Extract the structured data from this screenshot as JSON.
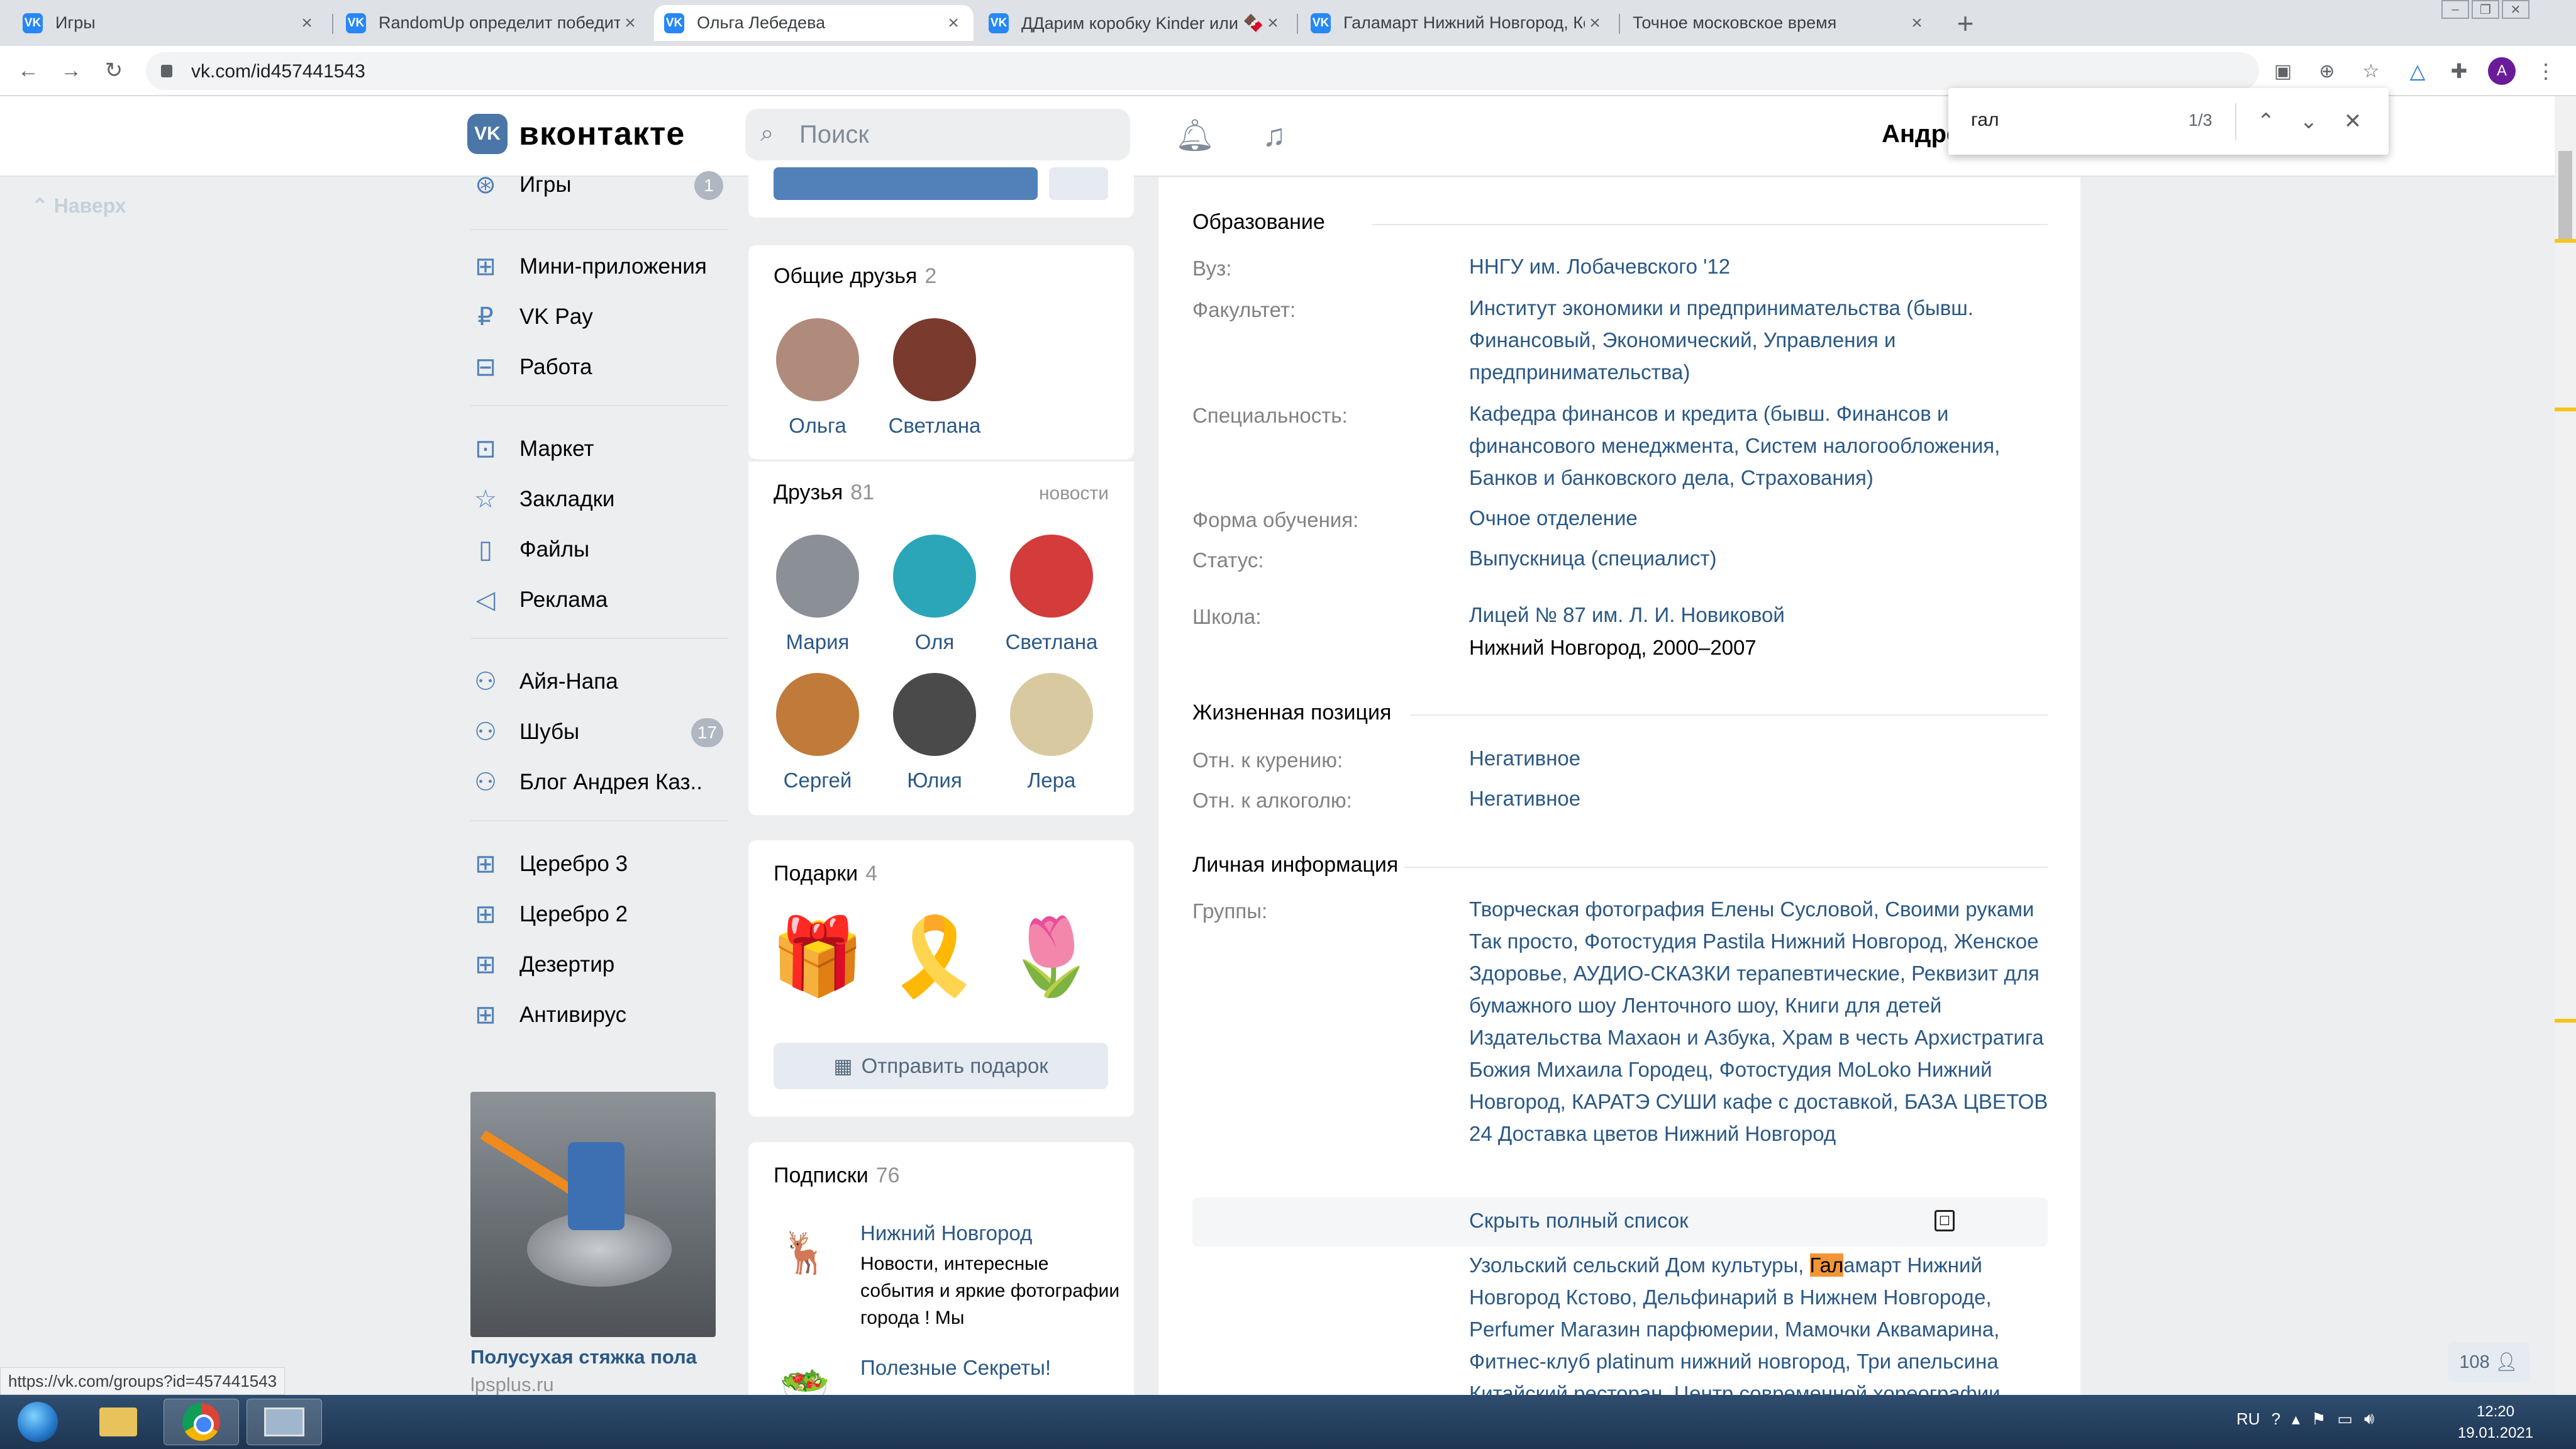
{
  "browser": {
    "tabs": [
      {
        "title": "Игры",
        "favicon": "vk-icon"
      },
      {
        "title": "RandomUp определит победите",
        "favicon": "vk-icon"
      },
      {
        "title": "Ольга Лебедева",
        "favicon": "vk-icon",
        "active": true
      },
      {
        "title": "ДДарим коробку Kinder или 🍫",
        "favicon": "vk-icon"
      },
      {
        "title": "Галамарт Нижний Новгород, Кс",
        "favicon": "vk-icon"
      },
      {
        "title": "Точное московское время",
        "favicon": "clock-icon"
      }
    ],
    "url": "vk.com/id457441543",
    "profile_initial": "A",
    "status_url": "https://vk.com/groups?id=457441543"
  },
  "find": {
    "query": "гал",
    "count": "1/3"
  },
  "vk": {
    "logo_text": "вконтакте",
    "search_placeholder": "Поиск",
    "user_name": "Андре"
  },
  "left_nav": {
    "back_to_top": "Наверх",
    "items": [
      {
        "label": "Игры",
        "icon": "gamepad-icon",
        "badge": "1"
      },
      {
        "label": "Мини-приложения",
        "icon": "apps-icon"
      },
      {
        "label": "VK Pay",
        "icon": "ruble-icon"
      },
      {
        "label": "Работа",
        "icon": "briefcase-icon"
      },
      {
        "label": "Маркет",
        "icon": "bag-icon"
      },
      {
        "label": "Закладки",
        "icon": "star-icon"
      },
      {
        "label": "Файлы",
        "icon": "file-icon"
      },
      {
        "label": "Реклама",
        "icon": "megaphone-icon"
      },
      {
        "label": "Айя-Напа",
        "icon": "group-icon"
      },
      {
        "label": "Шубы",
        "icon": "group-icon",
        "badge": "17"
      },
      {
        "label": "Блог Андрея Каз..",
        "icon": "group-icon"
      },
      {
        "label": "Церебро 3",
        "icon": "apps-icon"
      },
      {
        "label": "Церебро 2",
        "icon": "apps-icon"
      },
      {
        "label": "Дезертир",
        "icon": "apps-icon"
      },
      {
        "label": "Антивирус",
        "icon": "apps-icon"
      }
    ],
    "ad": {
      "title": "Полусухая стяжка пола",
      "domain": "lpsplus.ru"
    }
  },
  "mutual_friends": {
    "title": "Общие друзья",
    "count": "2",
    "people": [
      {
        "name": "Ольга",
        "color": "#b08a7a"
      },
      {
        "name": "Светлана",
        "color": "#7a3a2e"
      }
    ]
  },
  "friends": {
    "title": "Друзья",
    "count": "81",
    "link": "новости",
    "people": [
      {
        "name": "Мария",
        "color": "#8b8f96"
      },
      {
        "name": "Оля",
        "color": "#2aa6b8"
      },
      {
        "name": "Светлана",
        "color": "#d43b3b"
      },
      {
        "name": "Сергей",
        "color": "#c07a3a"
      },
      {
        "name": "Юлия",
        "color": "#4a4a4a"
      },
      {
        "name": "Лера",
        "color": "#d8c9a0"
      }
    ]
  },
  "gifts": {
    "title": "Подарки",
    "count": "4",
    "items": [
      "🎁",
      "🎗️",
      "🌷"
    ],
    "send_label": "Отправить подарок"
  },
  "subscriptions": {
    "title": "Подписки",
    "count": "76",
    "items": [
      {
        "name": "Нижний Новгород",
        "desc": "Новости, интересные события и яркие фотографии города ! Мы",
        "icon": "deer-icon"
      },
      {
        "name": "Полезные Секреты!",
        "desc": "",
        "icon": "food-icon"
      }
    ]
  },
  "profile": {
    "education_title": "Образование",
    "education": [
      {
        "label": "Вуз:",
        "value": "ННГУ им. Лобачевского '12"
      },
      {
        "label": "Факультет:",
        "value": "Институт экономики и предпринимательства (бывш. Финансовый, Экономический, Управления и предпринимательства)"
      },
      {
        "label": "Специальность:",
        "value": "Кафедра финансов и кредита (бывш. Финансов и финансового менеджмента, Систем налогообложения, Банков и банковского дела, Страхования)"
      },
      {
        "label": "Форма обучения:",
        "value": "Очное отделение"
      },
      {
        "label": "Статус:",
        "value": "Выпускница (специалист)"
      }
    ],
    "school_label": "Школа:",
    "school_value": "Лицей № 87 им. Л. И. Новиковой",
    "school_city": "Нижний Новгород, 2000–2007",
    "life_title": "Жизненная позиция",
    "life": [
      {
        "label": "Отн. к курению:",
        "value": "Негативное"
      },
      {
        "label": "Отн. к алкоголю:",
        "value": "Негативное"
      }
    ],
    "personal_title": "Личная информация",
    "groups_label": "Группы:",
    "groups_value": "Творческая фотография Елены Сусловой, Своими руками Так просто, Фотостудия Pastila Нижний Новгород, Женское Здоровье, АУДИО-СКАЗКИ терапевтические, Реквизит для бумажного шоу Ленточного шоу, Книги для детей Издательства Махаон и Азбука, Храм в честь Архистратига Божия Михаила Городец, Фотостудия MoLoko Нижний Новгород, КАРАТЭ СУШИ кафе с доставкой, БАЗА ЦВЕТОВ 24 Доставка цветов Нижний Новгород",
    "hide_label": "Скрыть полный список",
    "more_before": "Узольский сельский Дом культуры, ",
    "more_highlight": "Гал",
    "more_after": "амарт Нижний Новгород Кстово, Дельфинарий в Нижнем Новгороде, Perfumer Магазин парфюмерии, Мамочки Аквамарина, Фитнес-клуб platinum нижний новгород, Три апельсина Китайский ресторан, Центр современной хореографии"
  },
  "online_counter": "108",
  "taskbar": {
    "lang": "RU",
    "time": "12:20",
    "date": "19.01.2021"
  },
  "colors": {
    "link": "#2a5885",
    "accent": "#5181b8",
    "highlight": "#f29538"
  }
}
